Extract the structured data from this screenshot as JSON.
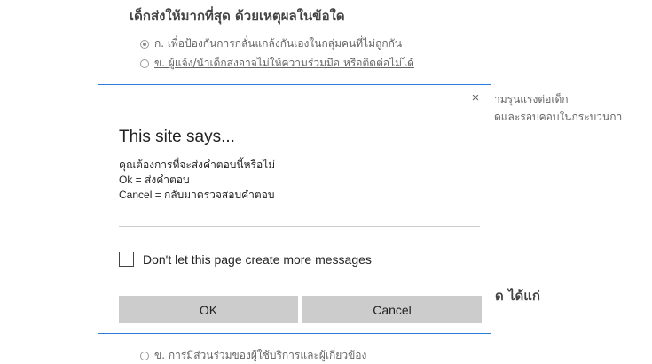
{
  "survey": {
    "question_title": "เด็กส่งให้มากที่สุด ด้วยเหตุผลในข้อใด",
    "options": [
      {
        "label": "ก. เพื่อป้องกันการกลั่นแกล้งกันเองในกลุ่มคนที่ไม่ถูกกัน",
        "checked": true
      },
      {
        "label": "ข. ผู้แจ้ง/นำเด็กส่งอาจไม่ให้ความร่วมมือ หรือติดต่อไม่ได้",
        "checked": false
      }
    ],
    "partial_text_1": "ามรุนแรงต่อเด็ก",
    "partial_text_2": "ดและรอบคอบในกระบวนกา",
    "partial_heading": "ด ได้แก่",
    "bottom_option": "ข. การมีส่วนร่วมของผู้ใช้บริการและผู้เกี่ยวข้อง"
  },
  "dialog": {
    "close_symbol": "×",
    "title": "This site says...",
    "message_lines": [
      "คุณต้องการที่จะส่งคำตอบนี้หรือไม่",
      "Ok = ส่งคำตอบ",
      "Cancel = กลับมาตรวจสอบคำตอบ"
    ],
    "checkbox_label": "Don't let this page create more messages",
    "ok_label": "OK",
    "cancel_label": "Cancel",
    "border_color": "#2b7bd8"
  }
}
